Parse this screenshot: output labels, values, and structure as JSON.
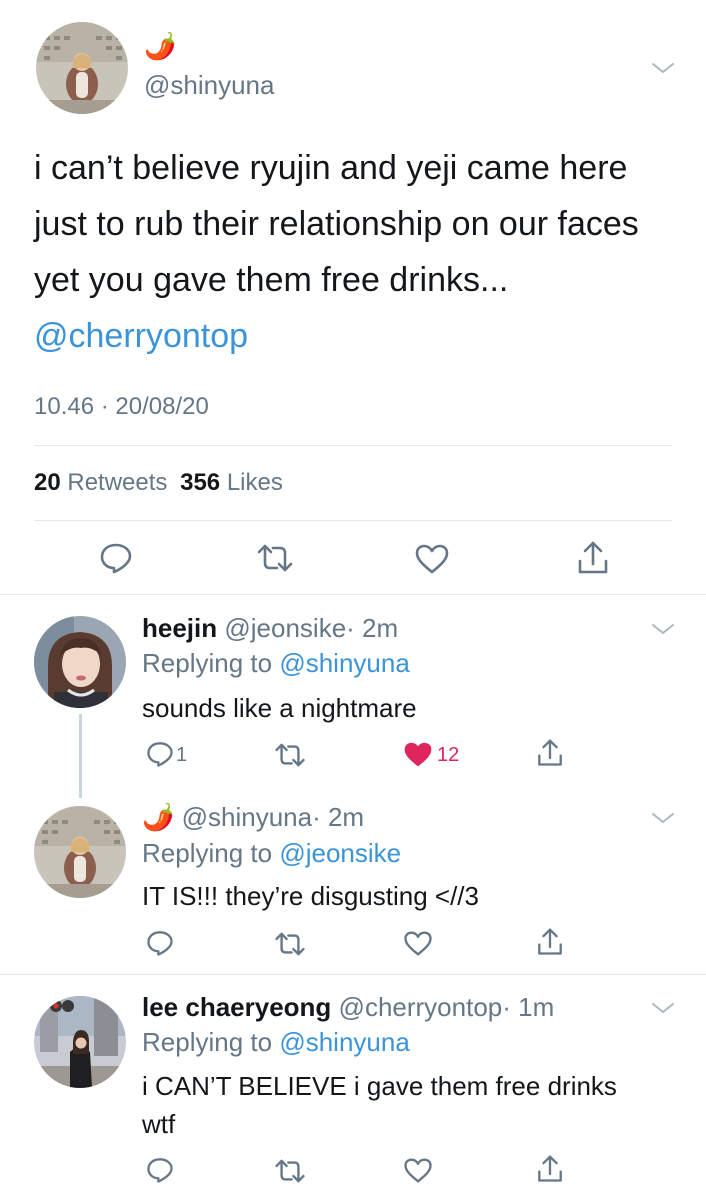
{
  "main_tweet": {
    "emoji": "🌶️",
    "handle": "@shinyuna",
    "text": "i can’t believe ryujin and yeji came here just to rub their relationship on our faces yet you gave them free drinks...",
    "mention": "@cherryontop",
    "timestamp": "10.46 · 20/08/20",
    "retweets_count": "20",
    "retweets_label": "Retweets",
    "likes_count": "356",
    "likes_label": "Likes"
  },
  "replies": [
    {
      "display_name": "heejin",
      "handle": "@jeonsike",
      "time": "· 2m",
      "replying_label": "Replying to",
      "replying_to": "@shinyuna",
      "text": "sounds like a nightmare",
      "reply_count": "1",
      "like_count": "12",
      "liked": true
    },
    {
      "emoji": "🌶️",
      "handle": "@shinyuna",
      "time": "· 2m",
      "replying_label": "Replying to",
      "replying_to": "@jeonsike",
      "text": "IT IS!!! they’re disgusting <//3"
    },
    {
      "display_name": "lee chaeryeong",
      "handle": "@cherryontop",
      "time": "· 1m",
      "replying_label": "Replying to",
      "replying_to": "@shinyuna",
      "text_line1": "i CAN’T BELIEVE i gave them free drinks",
      "text_line2": "wtf"
    }
  ],
  "colors": {
    "link": "#3b94d9",
    "muted": "#657786",
    "like": "#e0245e",
    "divider": "#e1e8ed"
  },
  "icons": [
    "reply-icon",
    "retweet-icon",
    "like-icon",
    "share-icon",
    "chevron-down-icon"
  ]
}
